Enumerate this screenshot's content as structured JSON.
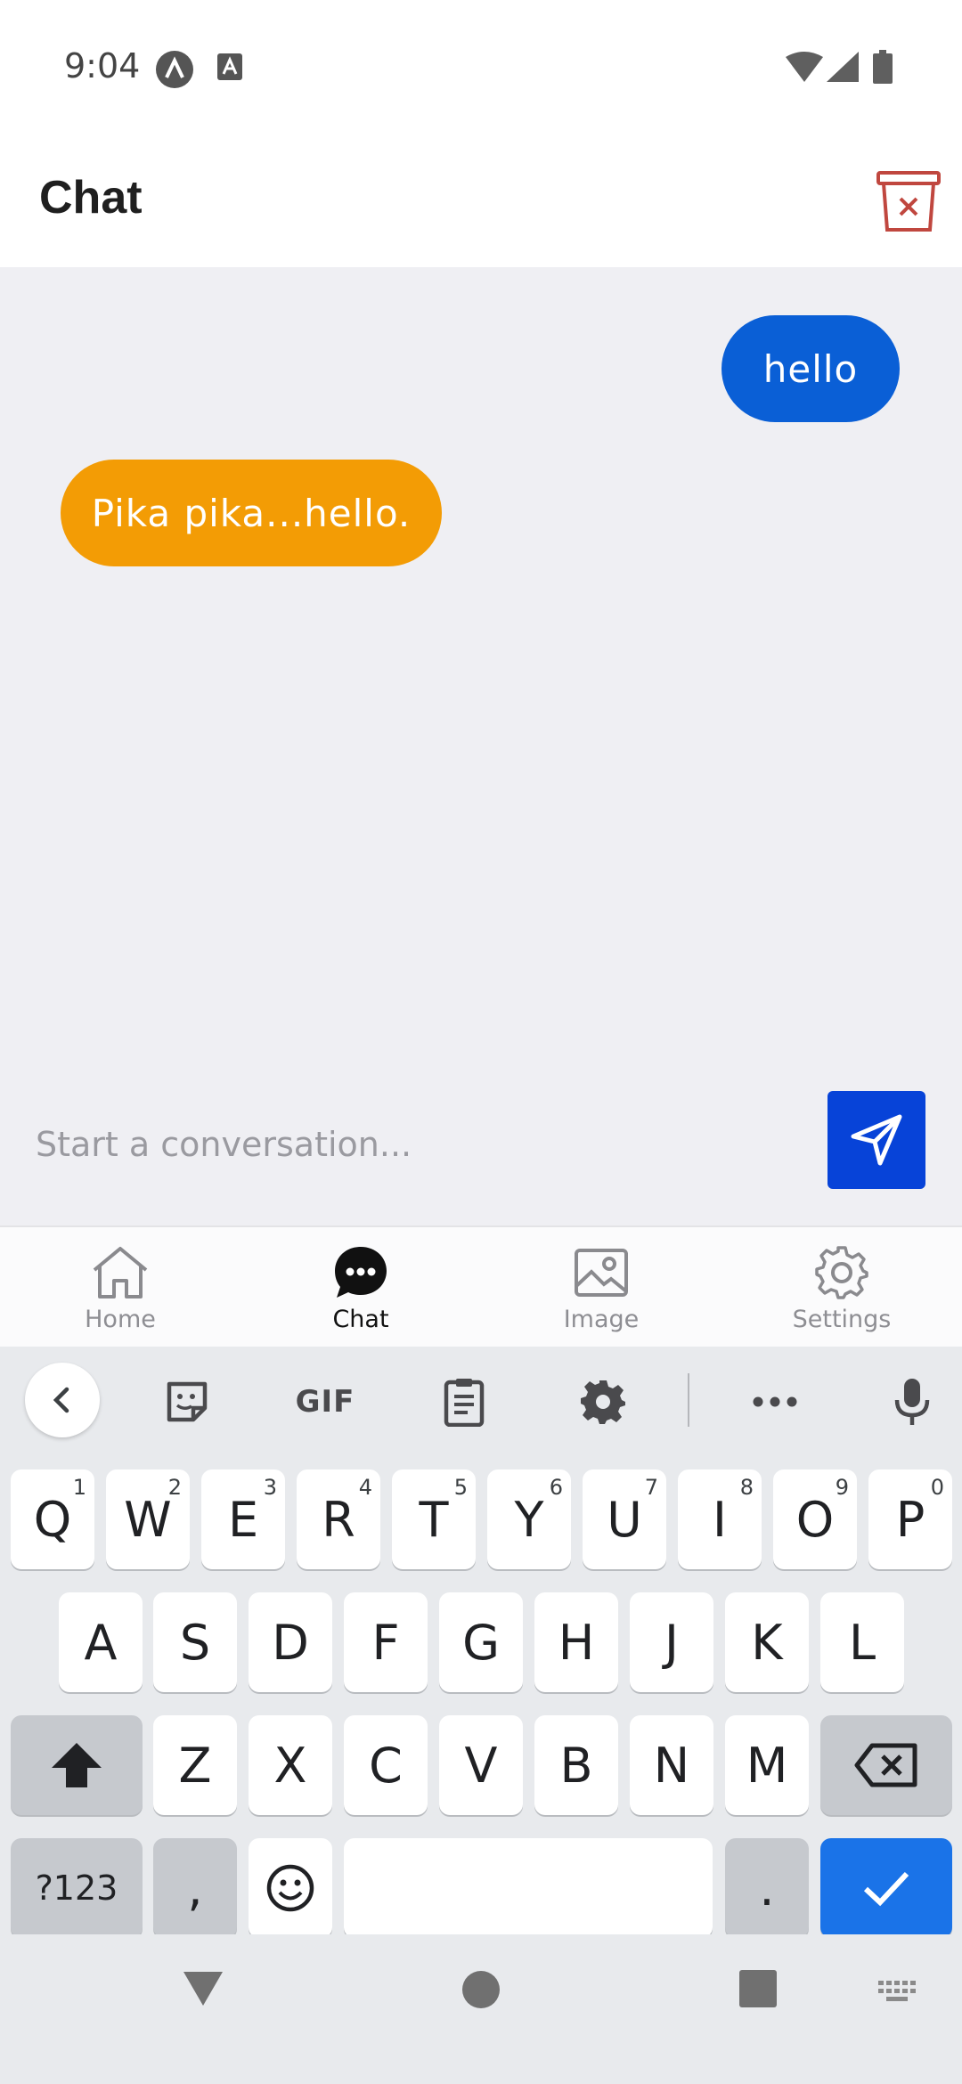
{
  "status_bar": {
    "time": "9:04",
    "icons": [
      "app-notification-icon",
      "text-notification-icon",
      "wifi-icon",
      "cell-signal-icon",
      "battery-icon"
    ]
  },
  "header": {
    "title": "Chat",
    "clear_icon": "trash-clear-icon"
  },
  "chat": {
    "messages": [
      {
        "sender": "user",
        "text": "hello",
        "color": "#0a5fd6"
      },
      {
        "sender": "bot",
        "text": "Pika pika...hello.",
        "color": "#f39c05"
      }
    ],
    "input_placeholder": "Start a conversation...",
    "input_value": "",
    "send_icon": "send-icon",
    "send_color": "#0743d8"
  },
  "bottom_nav": {
    "items": [
      {
        "label": "Home",
        "icon": "home-icon",
        "active": false
      },
      {
        "label": "Chat",
        "icon": "chat-bubble-icon",
        "active": true
      },
      {
        "label": "Image",
        "icon": "image-icon",
        "active": false
      },
      {
        "label": "Settings",
        "icon": "gear-icon",
        "active": false
      }
    ]
  },
  "keyboard": {
    "toolbar": {
      "gif_label": "GIF",
      "icons": [
        "chevron-left-icon",
        "sticker-icon",
        "gif-icon",
        "clipboard-icon",
        "gear-icon",
        "more-icon",
        "microphone-icon"
      ]
    },
    "row1": [
      {
        "key": "Q",
        "hint": "1"
      },
      {
        "key": "W",
        "hint": "2"
      },
      {
        "key": "E",
        "hint": "3"
      },
      {
        "key": "R",
        "hint": "4"
      },
      {
        "key": "T",
        "hint": "5"
      },
      {
        "key": "Y",
        "hint": "6"
      },
      {
        "key": "U",
        "hint": "7"
      },
      {
        "key": "I",
        "hint": "8"
      },
      {
        "key": "O",
        "hint": "9"
      },
      {
        "key": "P",
        "hint": "0"
      }
    ],
    "row2": [
      "A",
      "S",
      "D",
      "F",
      "G",
      "H",
      "J",
      "K",
      "L"
    ],
    "row3": [
      "Z",
      "X",
      "C",
      "V",
      "B",
      "N",
      "M"
    ],
    "symbols_label": "?123",
    "comma_label": ",",
    "period_label": ".",
    "action_color": "#1a73e8"
  },
  "system_nav": {
    "icons": [
      "back-triangle-icon",
      "home-circle-icon",
      "recents-square-icon",
      "keyboard-switch-icon"
    ]
  }
}
